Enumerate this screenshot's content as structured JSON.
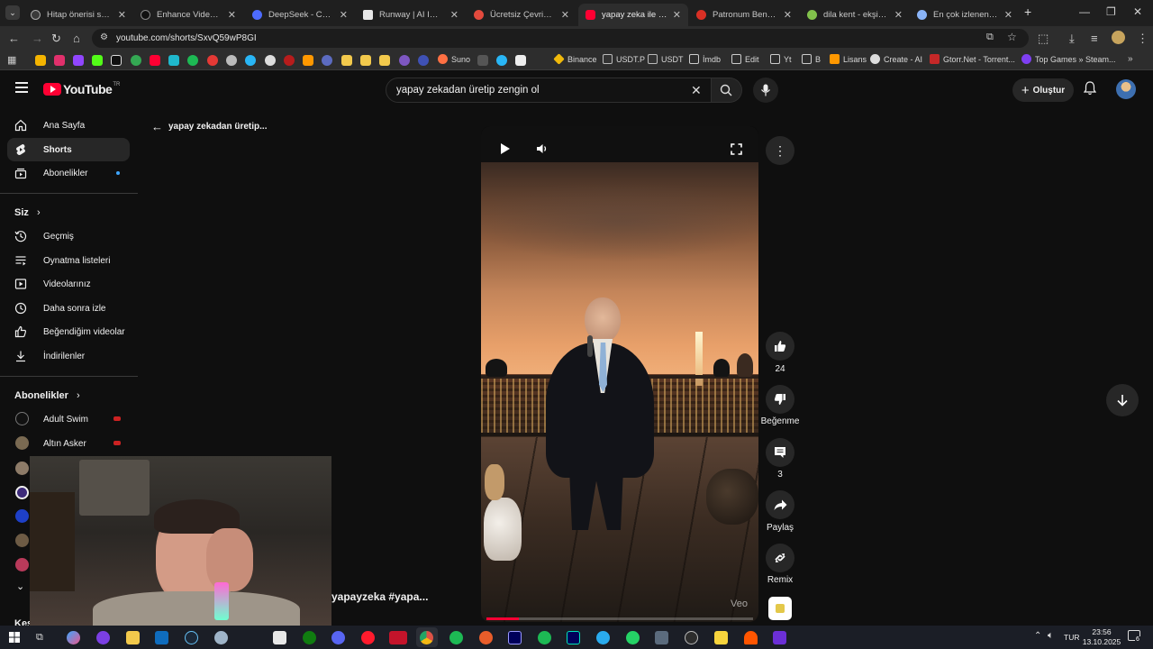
{
  "browser": {
    "tabs": [
      {
        "title": "Hitap önerisi sohbeti",
        "color": "#3a3a3a"
      },
      {
        "title": "Enhance Video Quali",
        "color": "#111111"
      },
      {
        "title": "DeepSeek - ChatPro",
        "color": "#4d6bfe"
      },
      {
        "title": "Runway | AI Image ar",
        "color": "#e8e8e8"
      },
      {
        "title": "Ücretsiz Çevrimiçi Yo",
        "color": "#e34a3d"
      },
      {
        "title": "yapay zeka ile zengin",
        "color": "#ff0033"
      },
      {
        "title": "Patronum Benden Ev",
        "color": "#d93025"
      },
      {
        "title": "dila kent - ekşi sözlük",
        "color": "#81c14b"
      },
      {
        "title": "En çok izlenen youtu",
        "color": "#8ab4f8"
      }
    ],
    "url": "youtube.com/shorts/SxvQ59wP8GI",
    "bookmarks": [
      "Suno",
      "Binance",
      "USDT.P",
      "USDT",
      "İmdb",
      "Edit",
      "Yt",
      "B",
      "Lisans",
      "Create - AI",
      "Gtorr.Net - Torrent...",
      "Top Games » Steam..."
    ]
  },
  "youtube": {
    "logo": "YouTube",
    "logo_sup": "TR",
    "search_query": "yapay zekadan üretip zengin ol",
    "create_label": "Oluştur",
    "back_title": "yapay zekadan üretip...",
    "video_caption": "yapayzeka #yapa...",
    "watermark": "Veo",
    "progress": 0.12,
    "actions": {
      "likes": "24",
      "dislike_label": "Beğenme",
      "comments": "3",
      "share_label": "Paylaş",
      "remix_label": "Remix"
    }
  },
  "sidebar": {
    "main": [
      {
        "label": "Ana Sayfa",
        "icon": "home-icon"
      },
      {
        "label": "Shorts",
        "icon": "shorts-icon"
      },
      {
        "label": "Abonelikler",
        "icon": "subscriptions-icon"
      }
    ],
    "you_header": "Siz",
    "you": [
      {
        "label": "Geçmiş",
        "icon": "history-icon"
      },
      {
        "label": "Oynatma listeleri",
        "icon": "playlists-icon"
      },
      {
        "label": "Videolarınız",
        "icon": "your-videos-icon"
      },
      {
        "label": "Daha sonra izle",
        "icon": "watch-later-icon"
      },
      {
        "label": "Beğendiğim videolar",
        "icon": "liked-icon"
      },
      {
        "label": "İndirilenler",
        "icon": "downloads-icon"
      }
    ],
    "subs_header": "Abonelikler",
    "subs": [
      {
        "label": "Adult Swim"
      },
      {
        "label": "Altın Asker"
      }
    ],
    "explore_partial": "Keşfet"
  },
  "taskbar": {
    "language": "TUR",
    "time": "23:56",
    "date": "13.10.2025",
    "notifications": "6"
  }
}
